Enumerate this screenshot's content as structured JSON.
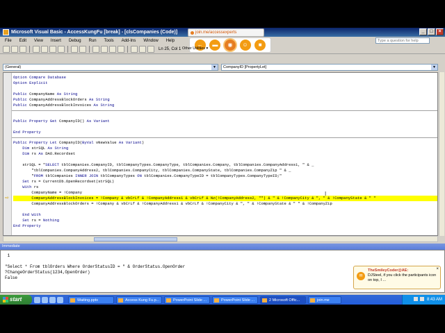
{
  "window": {
    "title": "Microsoft Visual Basic - AccessKungFu [break] - [clsCompanies (Code)]",
    "controls": [
      "_",
      "□",
      "×"
    ]
  },
  "joinme": {
    "url": "join.me/accessexperts",
    "buttons": [
      "←",
      "▬",
      "◉",
      "☺",
      "■"
    ]
  },
  "menu": {
    "items": [
      "File",
      "Edit",
      "View",
      "Insert",
      "Debug",
      "Run",
      "Tools",
      "Add-Ins",
      "Window",
      "Help"
    ],
    "help_placeholder": "Type a question for help"
  },
  "toolbar": {
    "status": "Ln 25, Col 1",
    "other_utilities": "Other Utilities ▾"
  },
  "code_window": {
    "object_combo": "(General)",
    "proc_combo": "CompanyID [PropertyLet]",
    "lines": [
      {
        "indent": 0,
        "text": "Option Compare Database"
      },
      {
        "indent": 0,
        "text": "Option Explicit"
      },
      {
        "indent": 0,
        "text": ""
      },
      {
        "indent": 0,
        "text": "Public CompanyName As String"
      },
      {
        "indent": 0,
        "text": "Public CompanyAddressBlockOrders As String"
      },
      {
        "indent": 0,
        "text": "Public CompanyAddressBlockInvoices As String"
      },
      {
        "sep": true
      },
      {
        "indent": 0,
        "text": ""
      },
      {
        "indent": 0,
        "text": "Public Property Get CompanyID() As Variant"
      },
      {
        "indent": 0,
        "text": ""
      },
      {
        "indent": 0,
        "text": "End Property"
      },
      {
        "sep": true
      },
      {
        "indent": 0,
        "text": "Public Property Let CompanyID(ByVal vNewValue As Variant)"
      },
      {
        "indent": 0,
        "text": "    Dim strSQL As String"
      },
      {
        "indent": 0,
        "text": "    Dim rs As DAO.Recordset"
      },
      {
        "indent": 0,
        "text": ""
      },
      {
        "indent": 0,
        "text": "    strSQL = \"SELECT tblCompanies.CompanyID, tblCompanyTypes.CompanyType, tblCompanies.Company, tblCompanies.CompanyAddress1, \" & _"
      },
      {
        "indent": 0,
        "text": "        \"tblCompanies.CompanyAddress2, tblCompanies.CompanyCity, tblCompanies.CompanyState, tblCompanies.CompanyZip \" & _"
      },
      {
        "indent": 0,
        "text": "        \"FROM tblCompanies INNER JOIN tblCompanyTypes ON tblCompanies.CompanyTypeID = tblCompanyTypes.CompanyTypeID;\""
      },
      {
        "indent": 0,
        "text": "    Set rs = CurrentDb.OpenRecordset(strSQL)"
      },
      {
        "indent": 0,
        "text": "    With rs"
      },
      {
        "indent": 0,
        "text": "        CompanyName = !Company"
      },
      {
        "indent": 0,
        "text": "        CompanyAddressBlockInvoices = !Company & vbCrLf & !CompanyAddress1 & vbCrLf & Nz(!CompanyAddress2, \"\") & \" & !CompanyCity & \", \" & !CompanyState & \" \"",
        "highlight": true
      },
      {
        "indent": 0,
        "text": "        CompanyAddressBlockOrders = !Company & vbCrLf & !CompanyAddress1 & vbCrLf & !CompanyCity & \", \" & !CompanyState & \" \" & !CompanyZip"
      },
      {
        "indent": 0,
        "text": ""
      },
      {
        "indent": 0,
        "text": "    End With"
      },
      {
        "indent": 0,
        "text": "    Set rs = Nothing"
      },
      {
        "indent": 0,
        "text": "End Property"
      }
    ]
  },
  "immediate": {
    "title": "Immediate",
    "lines": [
      " 1",
      "",
      "\"Select * From tblOrders Where OrderStatusID = \" & OrderStatus.OpenOrder",
      "?ChangeOrderStatus(1234,OpenOrder)",
      "False"
    ]
  },
  "chat": {
    "name": "TheSmileyCoder@AE:",
    "message": "DJSteel, if you click the participants icon on top, I ...",
    "close": "×"
  },
  "taskbar": {
    "start": "start",
    "tasks": [
      "Waiting.pptx",
      "Access Kung Fu.p...",
      "PowerPoint Slide ...",
      "PowerPoint Slide ...",
      "2 Microsoft Offic...",
      "join.me"
    ],
    "active_task_index": 4,
    "clock": "8:43 AM"
  }
}
